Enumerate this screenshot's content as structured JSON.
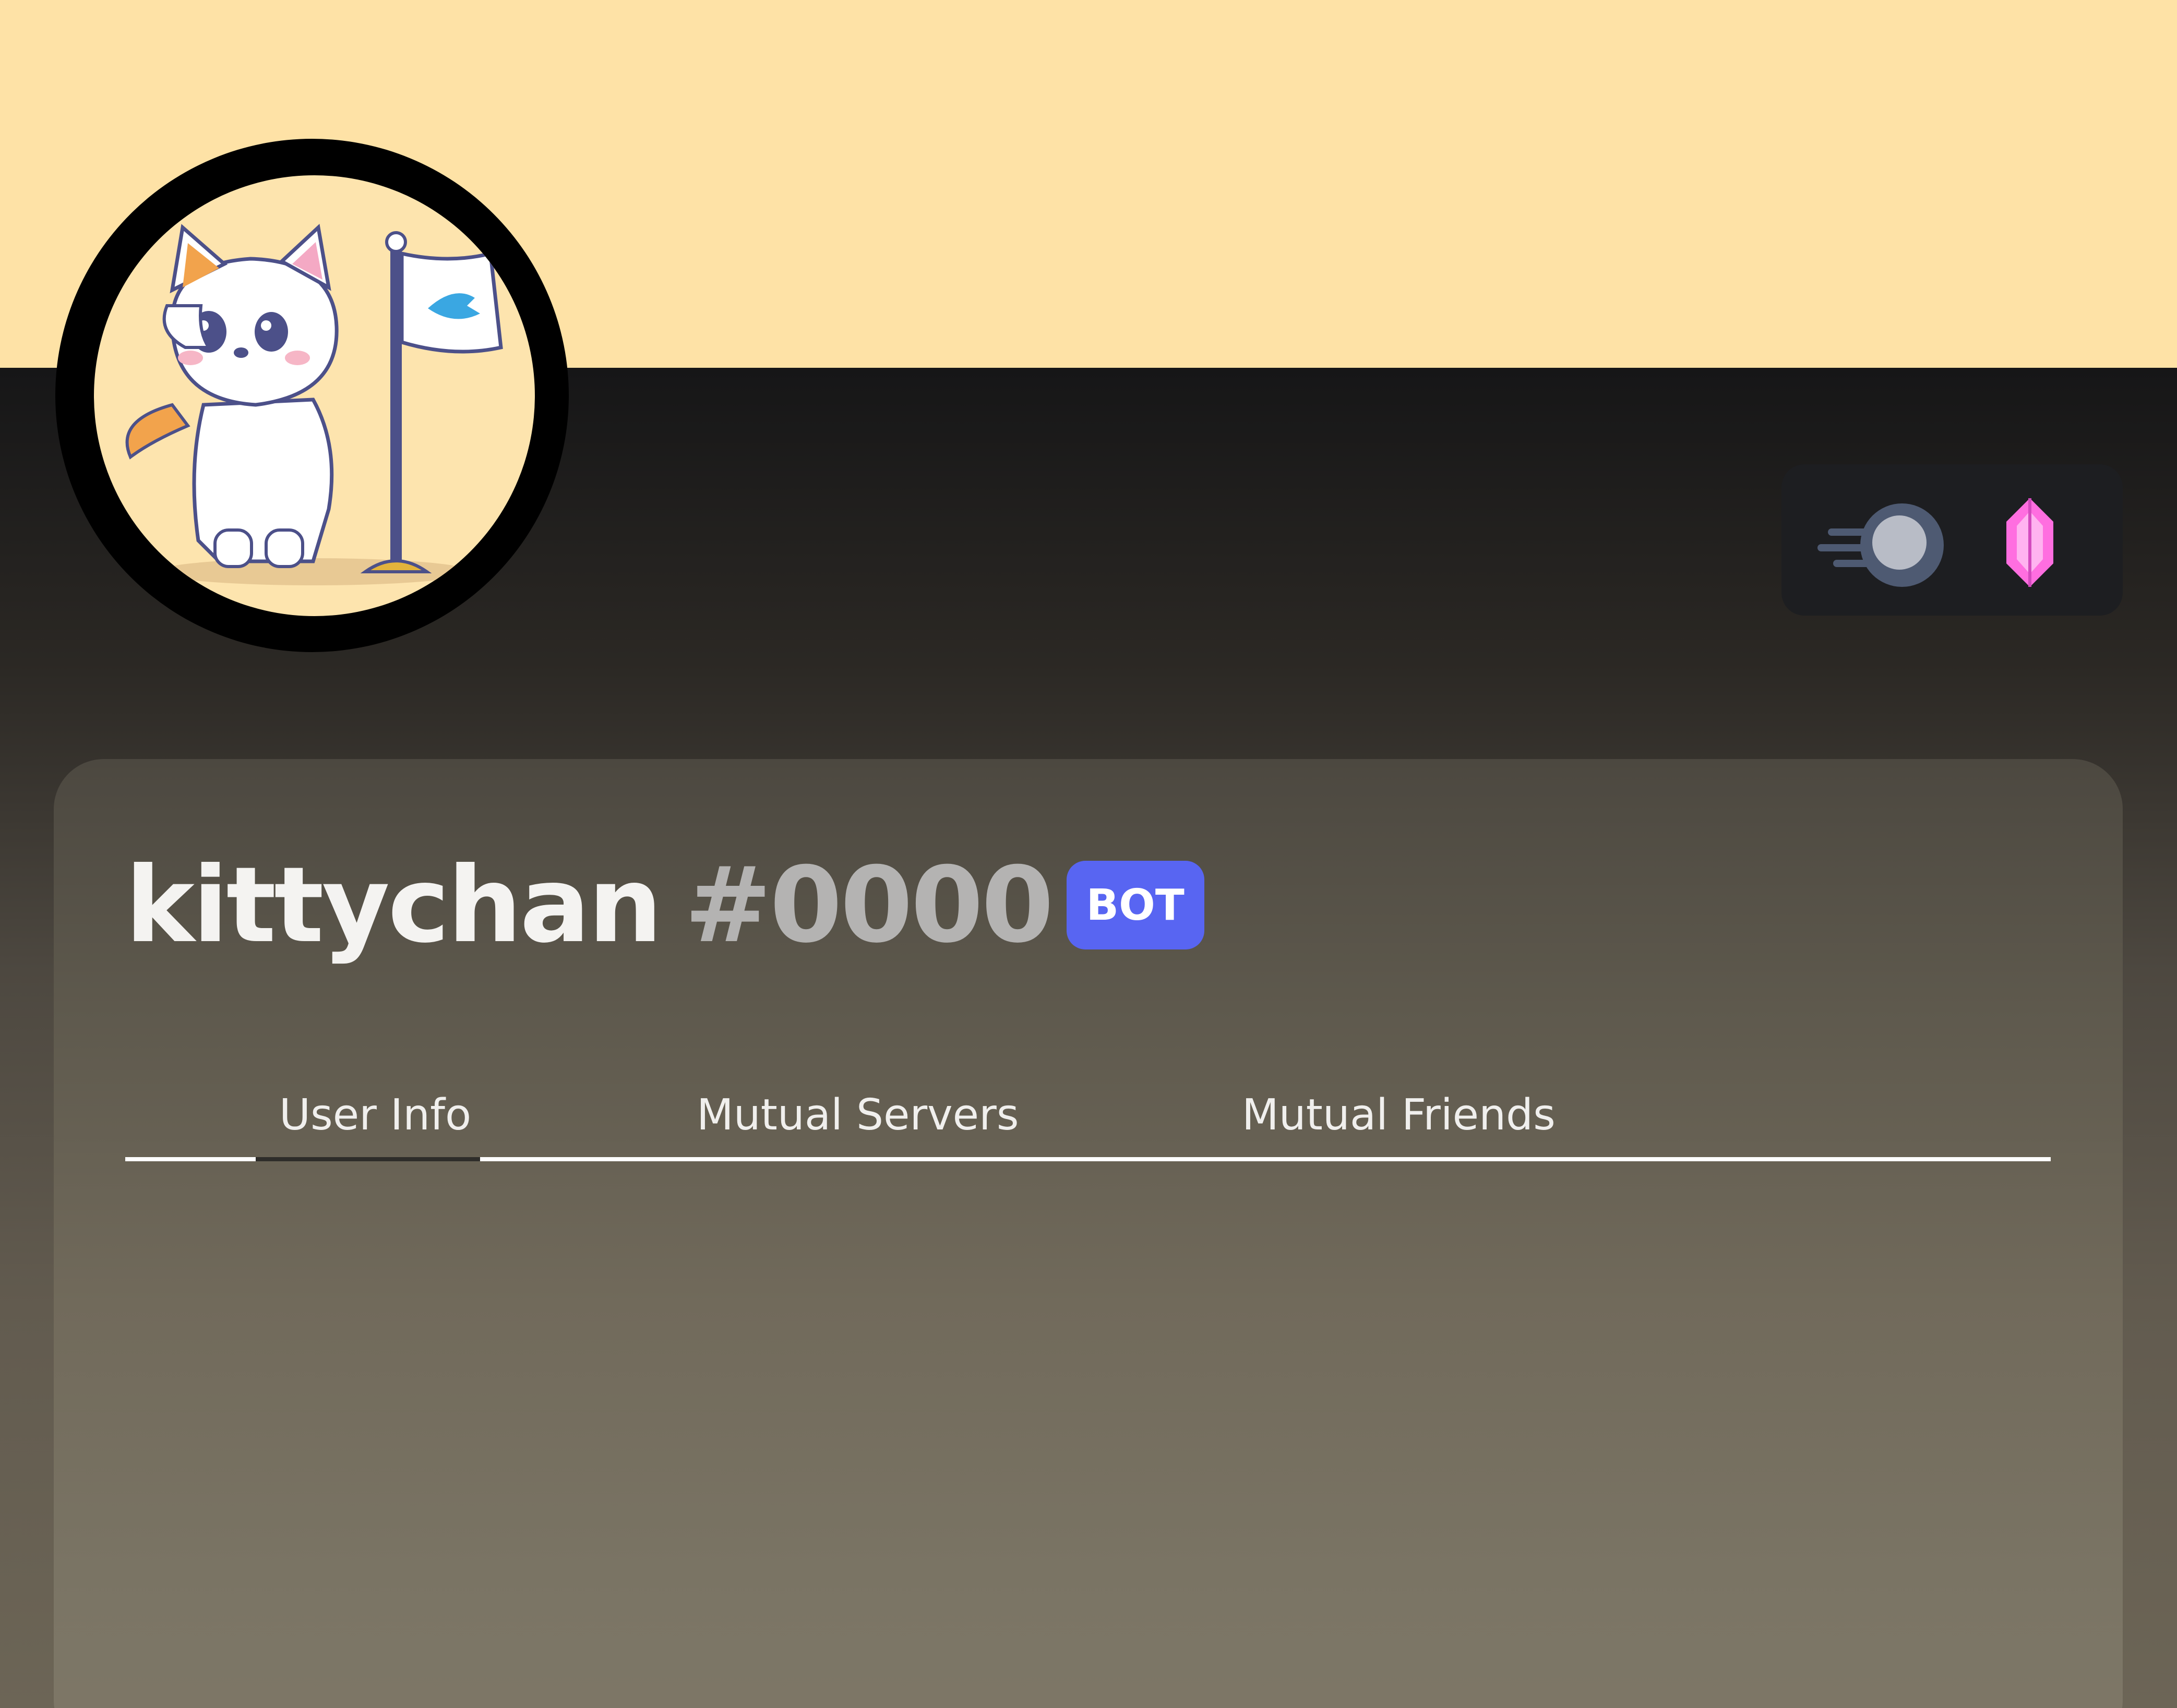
{
  "profile": {
    "username": "kittychan",
    "discriminator": "#0000",
    "bot_tag": "BOT"
  },
  "badges": [
    {
      "name": "server-booster-badge",
      "color": "#4e5a72"
    },
    {
      "name": "gem-badge",
      "color": "#ff6ee0"
    }
  ],
  "tabs": [
    {
      "label": "User Info",
      "selected": true
    },
    {
      "label": "Mutual Servers",
      "selected": false
    },
    {
      "label": "Mutual Friends",
      "selected": false
    }
  ],
  "colors": {
    "banner": "#fee2a6",
    "bot_tag": "#5865f2",
    "text_primary": "#f4f3f1",
    "text_muted": "#b4b3b2"
  }
}
